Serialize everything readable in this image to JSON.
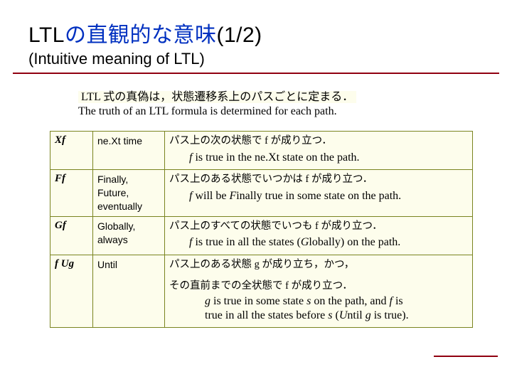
{
  "title": {
    "prefix_black": "LTL",
    "mid_blue": "の直観的な意味",
    "suffix_black": "(1/2)"
  },
  "subtitle": "(Intuitive meaning of LTL)",
  "intro": {
    "ja": "LTL 式の真偽は，状態遷移系上のパスごとに定まる．",
    "en": "The truth of an LTL formula is determined for each path."
  },
  "rows": [
    {
      "op": "Xf",
      "name": "ne.Xt time",
      "ja": "パス上の次の状態で f が成り立つ．",
      "en_pre": "f",
      "en_post": " is true in the ne.Xt state on the path."
    },
    {
      "op": "Ff",
      "name": "Finally,\nFuture,\neventually",
      "ja": "パス上のある状態でいつかは f が成り立つ．",
      "en_pre": "f ",
      "en_mid": " will be ",
      "en_em": "F",
      "en_post": "inally true in some state on the path."
    },
    {
      "op": "Gf",
      "name": "Globally,\nalways",
      "ja": "パス上のすべての状態でいつも f が成り立つ．",
      "en_pre": "f",
      "en_mid": " is true in all the states (",
      "en_em": "G",
      "en_post": "lobally) on the path."
    },
    {
      "op": "f Ug",
      "name": "Until",
      "ja1": "パス上のある状態 g が成り立ち，かつ，",
      "ja2": "その直前までの全状態で f が成り立つ．",
      "en_line1_a": "g",
      "en_line1_b": " is true in some state ",
      "en_line1_c": "s",
      "en_line1_d": " on the path, and ",
      "en_line1_e": "f",
      "en_line1_f": " is",
      "en_line2_a": "true in all the states before ",
      "en_line2_b": "s",
      "en_line2_c": " (",
      "en_line2_d": "U",
      "en_line2_e": "ntil ",
      "en_line2_f": "g",
      "en_line2_g": " is true)."
    }
  ]
}
